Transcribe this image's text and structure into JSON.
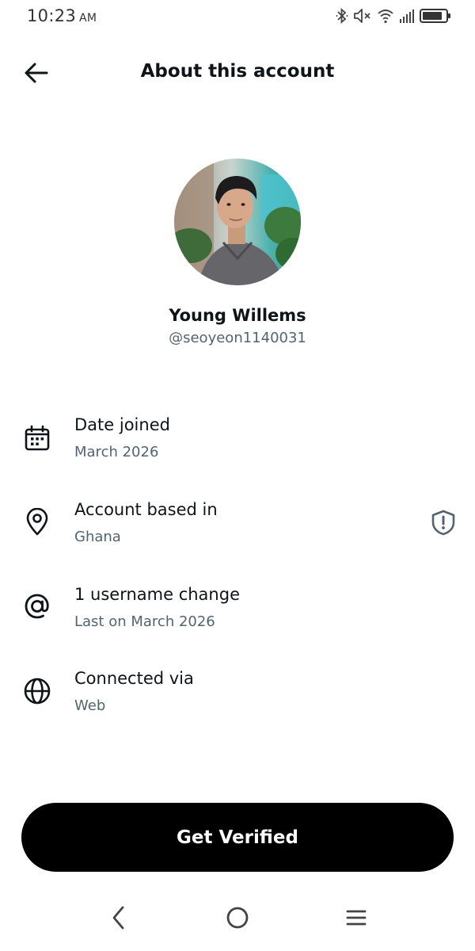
{
  "status_bar": {
    "time": "10:23",
    "ampm": "AM"
  },
  "header": {
    "title": "About this account",
    "back_icon": "arrow-left-icon"
  },
  "profile": {
    "name": "Young Willems",
    "handle": "@seoyeon1140031"
  },
  "rows": [
    {
      "icon": "calendar-icon",
      "title": "Date joined",
      "subtitle": "March 2026"
    },
    {
      "icon": "location-pin-icon",
      "title": "Account based in",
      "subtitle": "Ghana",
      "action_icon": "shield-alert-icon"
    },
    {
      "icon": "at-sign-icon",
      "title": "1 username change",
      "subtitle": "Last on March 2026"
    },
    {
      "icon": "globe-icon",
      "title": "Connected via",
      "subtitle": "Web"
    }
  ],
  "cta": {
    "label": "Get Verified"
  },
  "colors": {
    "text_primary": "#0f1419",
    "text_secondary": "#536471",
    "button_bg": "#000000",
    "button_text": "#ffffff"
  }
}
